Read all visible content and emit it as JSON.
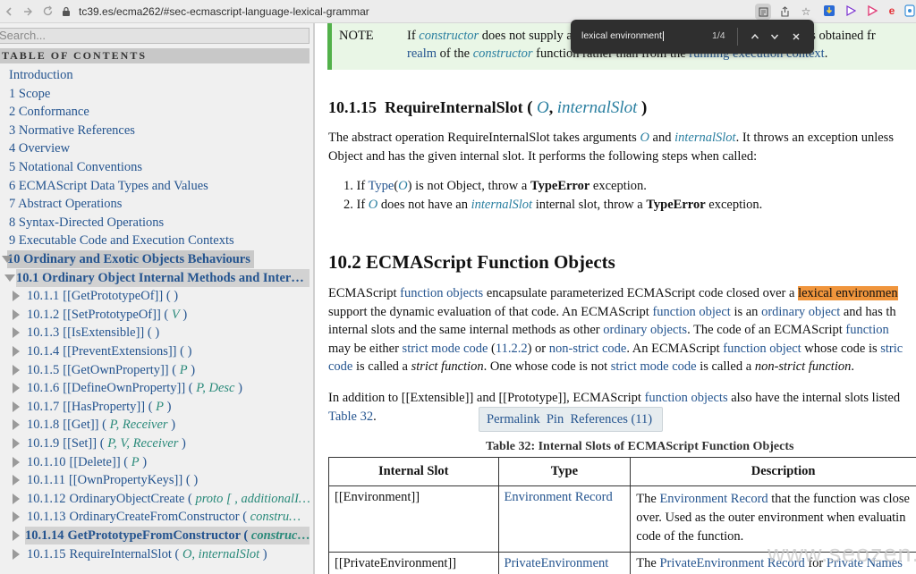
{
  "browser": {
    "url": "tc39.es/ecma262/#sec-ecmascript-language-lexical-grammar",
    "extension_icons": [
      "download-icon",
      "play-icon",
      "play-icon",
      "ebay-icon",
      "prime-icon"
    ]
  },
  "find": {
    "query": "lexical environment",
    "count": "1/4"
  },
  "sidebar": {
    "search_placeholder": "Search...",
    "toc_heading": "TABLE OF CONTENTS",
    "items": [
      {
        "label": "Introduction"
      },
      {
        "label": "1 Scope"
      },
      {
        "label": "2 Conformance"
      },
      {
        "label": "3 Normative References"
      },
      {
        "label": "4 Overview"
      },
      {
        "label": "5 Notational Conventions"
      },
      {
        "label": "6 ECMAScript Data Types and Values"
      },
      {
        "label": "7 Abstract Operations"
      },
      {
        "label": "8 Syntax-Directed Operations"
      },
      {
        "label": "9 Executable Code and Execution Contexts"
      },
      {
        "label": "10 Ordinary and Exotic Objects Behaviours"
      },
      {
        "label": "10.1 Ordinary Object Internal Methods and Inter…"
      },
      {
        "num": "10.1.1",
        "name": "[[GetPrototypeOf]]",
        "args": ""
      },
      {
        "num": "10.1.2",
        "name": "[[SetPrototypeOf]]",
        "args": "V"
      },
      {
        "num": "10.1.3",
        "name": "[[IsExtensible]]",
        "args": ""
      },
      {
        "num": "10.1.4",
        "name": "[[PreventExtensions]]",
        "args": ""
      },
      {
        "num": "10.1.5",
        "name": "[[GetOwnProperty]]",
        "args": "P"
      },
      {
        "num": "10.1.6",
        "name": "[[DefineOwnProperty]]",
        "args": "P, Desc"
      },
      {
        "num": "10.1.7",
        "name": "[[HasProperty]]",
        "args": "P"
      },
      {
        "num": "10.1.8",
        "name": "[[Get]]",
        "args": "P, Receiver"
      },
      {
        "num": "10.1.9",
        "name": "[[Set]]",
        "args": "P, V, Receiver"
      },
      {
        "num": "10.1.10",
        "name": "[[Delete]]",
        "args": "P"
      },
      {
        "num": "10.1.11",
        "name": "[[OwnPropertyKeys]]",
        "args": ""
      },
      {
        "num": "10.1.12",
        "name": "OrdinaryObjectCreate",
        "args": "proto [ , additionalI…"
      },
      {
        "num": "10.1.13",
        "name": "OrdinaryCreateFromConstructor",
        "args": "constru…"
      },
      {
        "num": "10.1.14",
        "name": "GetPrototypeFromConstructor",
        "args": "construc…"
      },
      {
        "num": "10.1.15",
        "name": "RequireInternalSlot",
        "args": "O, internalSlot"
      }
    ]
  },
  "content": {
    "note_label": "NOTE",
    "note_line1_pre": "If ",
    "note_line1_link": "constructor",
    "note_line1_post": " does not supply a",
    "note_line1_tail": " used is obtained fr",
    "note_line2_a": "realm",
    "note_line2_b": " of the ",
    "note_line2_c": "constructor",
    "note_line2_d": " function rather than from the ",
    "note_line2_e": "running execution context",
    "note_line2_f": ".",
    "section_1015_num": "10.1.15",
    "section_1015_name": "RequireInternalSlot",
    "section_1015_arg1": "O",
    "section_1015_arg2": "internalSlot",
    "p1_a": "The abstract operation RequireInternalSlot takes arguments ",
    "p1_b": "O",
    "p1_c": " and ",
    "p1_d": "internalSlot",
    "p1_e": ". It throws an exception unless",
    "p1_line2": "Object and has the given internal slot. It performs the following steps when called:",
    "step1_a": "1. If ",
    "step1_b": "Type",
    "step1_c": "(",
    "step1_d": "O",
    "step1_e": ") is not Object, throw a ",
    "step1_f": "TypeError",
    "step1_g": " exception.",
    "step2_a": "2. If ",
    "step2_b": "O",
    "step2_c": " does not have an ",
    "step2_d": "internalSlot",
    "step2_e": " internal slot, throw a ",
    "step2_f": "TypeError",
    "step2_g": " exception.",
    "section_102": "10.2  ECMAScript Function Objects",
    "p2_l1_a": "ECMAScript ",
    "p2_l1_b": "function objects",
    "p2_l1_c": " encapsulate parameterized ECMAScript code closed over a ",
    "p2_l1_d": "lexical environmen",
    "p2_l2_a": "support the dynamic evaluation of that code. An ECMAScript ",
    "p2_l2_b": "function object",
    "p2_l2_c": " is an ",
    "p2_l2_d": "ordinary object",
    "p2_l2_e": " and has th",
    "p2_l3_a": "internal slots and the same internal methods as other ",
    "p2_l3_b": "ordinary objects",
    "p2_l3_c": ". The code of an ECMAScript ",
    "p2_l3_d": "function",
    "p2_l4_a": "may be either ",
    "p2_l4_b": "strict mode code",
    "p2_l4_c": " (",
    "p2_l4_d": "11.2.2",
    "p2_l4_e": ") or ",
    "p2_l4_f": "non-strict code",
    "p2_l4_g": ". An ECMAScript ",
    "p2_l4_h": "function object",
    "p2_l4_i": " whose code is ",
    "p2_l4_j": "stric",
    "p2_l5_a": "code",
    "p2_l5_b": " is called a ",
    "p2_l5_c": "strict function",
    "p2_l5_d": ". One whose code is not ",
    "p2_l5_e": "strict mode code",
    "p2_l5_f": " is called a ",
    "p2_l5_g": "non-strict function",
    "p2_l5_h": ".",
    "p3_a": "In addition to [[Extensible]] and [[Prototype]], ECMAScript ",
    "p3_b": "function objects",
    "p3_c": " also have the internal slots listed",
    "p3_d": "Table 32",
    "p3_e": ".",
    "popover_permalink": "Permalink",
    "popover_pin": "Pin",
    "popover_refs": "References (11)",
    "table_caption": "Table 32: Internal Slots of ECMAScript Function Objects",
    "table_headers": [
      "Internal Slot",
      "Type",
      "Description"
    ],
    "row1_slot": "[[Environment]]",
    "row1_type": "Environment Record",
    "row1_desc_a": "The ",
    "row1_desc_b": "Environment Record",
    "row1_desc_c": " that the function was close",
    "row1_desc_l2": "over. Used as the outer environment when evaluatin",
    "row1_desc_l3": "code of the function.",
    "row2_slot": "[[PrivateEnvironment]]",
    "row2_type": "PrivateEnvironment",
    "row2_desc_a": "The ",
    "row2_desc_b": "PrivateEnvironment Record",
    "row2_desc_c": " for ",
    "row2_desc_d": "Private Names"
  },
  "watermark": "www.seozen.top"
}
